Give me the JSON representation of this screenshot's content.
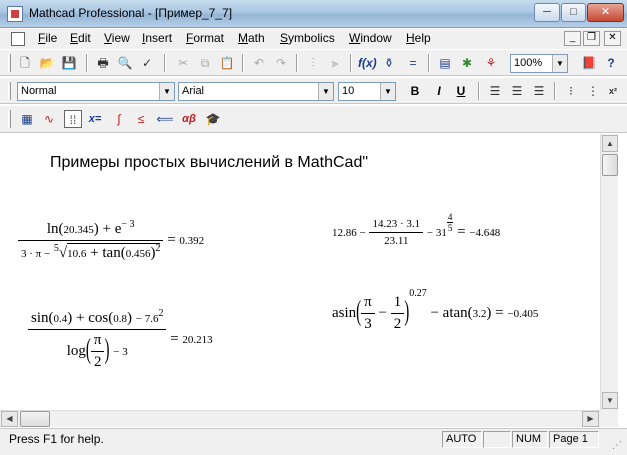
{
  "window": {
    "title": "Mathcad Professional - [Пример_7_7]",
    "min_glyph": "─",
    "max_glyph": "□",
    "close_glyph": "✕"
  },
  "menu": {
    "items": [
      "File",
      "Edit",
      "View",
      "Insert",
      "Format",
      "Math",
      "Symbolics",
      "Window",
      "Help"
    ],
    "mdi_min": "_",
    "mdi_restore": "❐",
    "mdi_close": "✕"
  },
  "toolbar": {
    "zoom": "100%",
    "help_glyph": "?",
    "icons": [
      "new-icon",
      "open-icon",
      "save-icon",
      "print-icon",
      "print-preview-icon",
      "spell-check-icon",
      "cut-icon",
      "copy-icon",
      "paste-icon",
      "undo-icon",
      "redo-icon",
      "align-top-icon",
      "align-bottom-icon",
      "insert-function-icon",
      "insert-unit-icon",
      "calculate-icon",
      "insert-component-icon",
      "resources-icon"
    ]
  },
  "format": {
    "style": "Normal",
    "font": "Arial",
    "size": "10",
    "bold": "B",
    "italic": "I",
    "underline": "U"
  },
  "math_toolbar": {
    "icons": [
      "calculator-palette-icon",
      "graph-palette-icon",
      "matrix-palette-icon",
      "evaluation-palette-icon",
      "calculus-palette-icon",
      "boolean-palette-icon",
      "programming-palette-icon",
      "greek-palette-icon",
      "symbolic-palette-icon"
    ],
    "eval_label": "x=",
    "greek_label": "αβ"
  },
  "worksheet": {
    "heading": "Примеры простых вычислений в MathCad\"",
    "expr1": {
      "num_ln": "ln",
      "num_arg": "20.345",
      "num_plus": "+ e",
      "num_exp": "− 3",
      "den_left": "3 · π −",
      "den_root_index": "5",
      "den_root_val": "10.6",
      "den_plus": "+ tan",
      "den_arg": "0.456",
      "den_exp": "2",
      "result": "0.392"
    },
    "expr2": {
      "lead": "12.86 −",
      "num": "14.23 · 3.1",
      "den": "23.11",
      "minus": "− 31",
      "exp_num": "4",
      "exp_den": "5",
      "result": "−4.648"
    },
    "expr3": {
      "sin": "sin",
      "sin_arg": "0.4",
      "cos": "+ cos",
      "cos_arg": "0.8",
      "sq": "− 7.6",
      "sq_exp": "2",
      "log": "log",
      "pi": "π",
      "two": "2",
      "minus3": "− 3",
      "result": "20.213"
    },
    "expr4": {
      "asin": "asin",
      "pi": "π",
      "three": "3",
      "minus": "−",
      "one": "1",
      "two": "2",
      "power": "0.27",
      "atan": "− atan",
      "atan_arg": "3.2",
      "result": "−0.405"
    },
    "equals": "="
  },
  "status": {
    "help": "Press F1 for help.",
    "auto": "AUTO",
    "num": "NUM",
    "page": "Page 1"
  }
}
